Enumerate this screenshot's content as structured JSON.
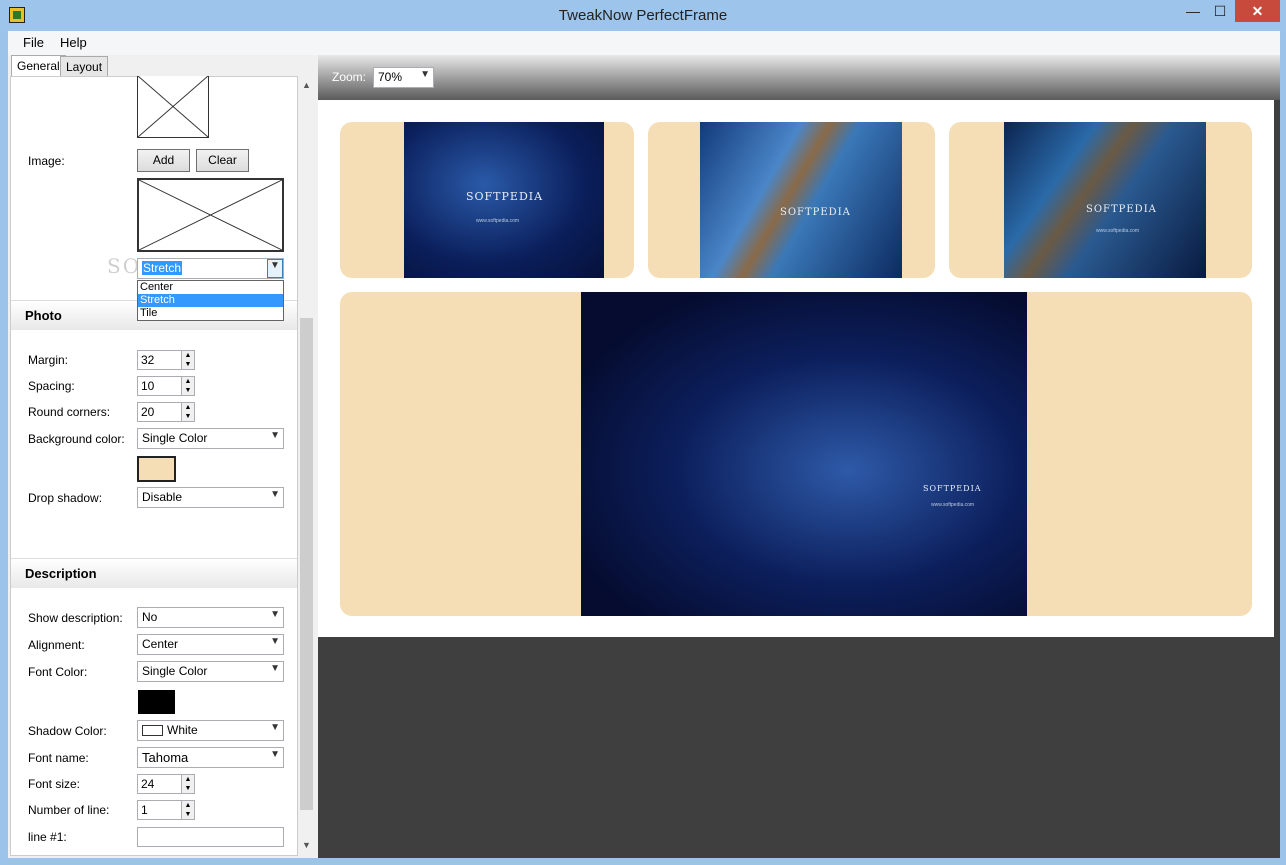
{
  "window": {
    "title": "TweakNow PerfectFrame",
    "min": "—",
    "max": "☐",
    "close": "✕"
  },
  "menu": [
    "File",
    "Help"
  ],
  "tabs": [
    "General",
    "Layout"
  ],
  "image": {
    "label": "Image:",
    "add": "Add",
    "clear": "Clear",
    "mode_value": "Stretch",
    "mode_options": [
      "Center",
      "Stretch",
      "Tile"
    ]
  },
  "photo": {
    "heading": "Photo",
    "margin_label": "Margin:",
    "margin": "32",
    "spacing_label": "Spacing:",
    "spacing": "10",
    "corners_label": "Round corners:",
    "corners": "20",
    "bg_label": "Background color:",
    "bg": "Single Color",
    "bg_color": "#f5deb5",
    "shadow_label": "Drop shadow:",
    "shadow": "Disable"
  },
  "description": {
    "heading": "Description",
    "show_label": "Show description:",
    "show": "No",
    "align_label": "Alignment:",
    "align": "Center",
    "fontcolor_label": "Font Color:",
    "fontcolor": "Single Color",
    "fontcolor_swatch": "#000000",
    "shadowcolor_label": "Shadow Color:",
    "shadowcolor": "White",
    "fontname_label": "Font name:",
    "fontname": "Tahoma",
    "fontsize_label": "Font size:",
    "fontsize": "24",
    "lines_label": "Number of line:",
    "lines": "1",
    "line1_label": "line #1:",
    "line1": ""
  },
  "zoom": {
    "label": "Zoom:",
    "value": "70%"
  },
  "preview": {
    "brand": "SOFTPEDIA",
    "trademark": "™",
    "url": "www.softpedia.com",
    "frame_color": "#f5deb5"
  },
  "watermark": "SOFTPEDIA"
}
